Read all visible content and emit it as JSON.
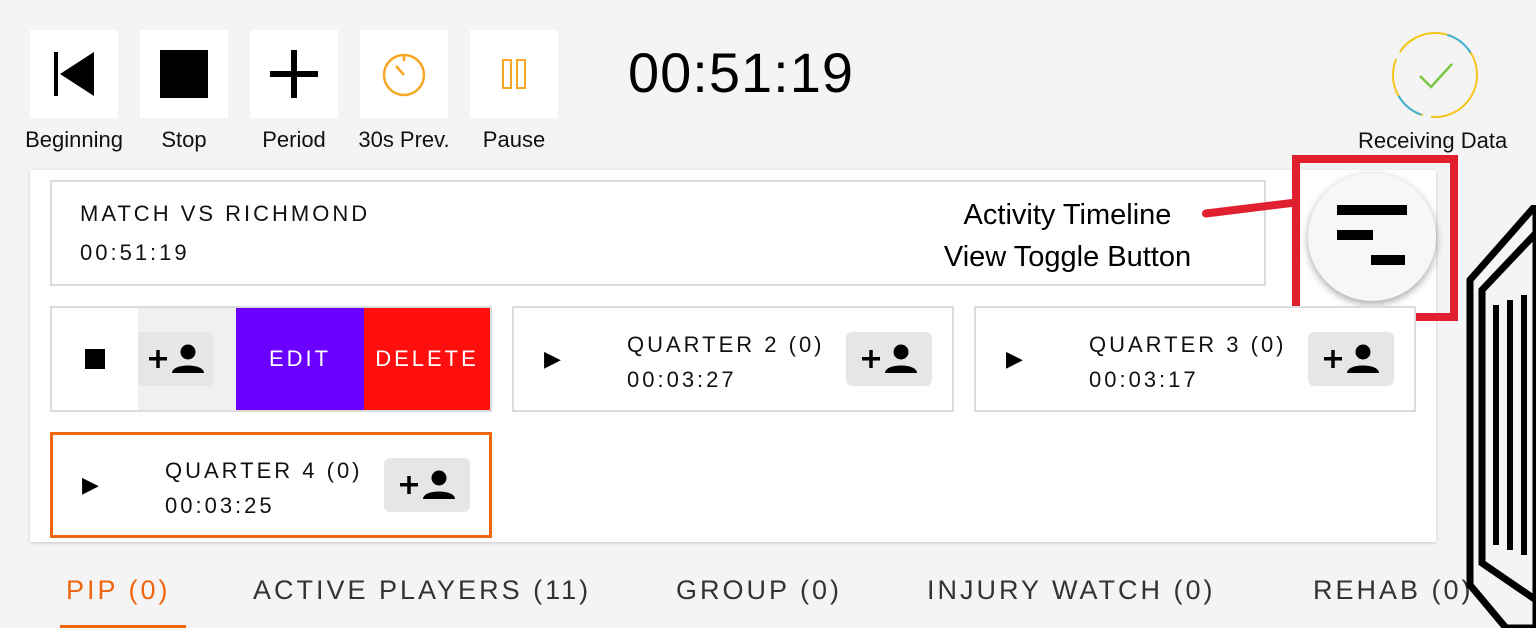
{
  "toolbar": {
    "beginning_label": "Beginning",
    "stop_label": "Stop",
    "period_label": "Period",
    "prev30_label": "30s Prev.",
    "pause_label": "Pause"
  },
  "clock": "00:51:19",
  "status": {
    "label": "Receiving Data"
  },
  "match": {
    "title": "MATCH VS RICHMOND",
    "time": "00:51:19"
  },
  "annotation": {
    "line1": "Activity Timeline",
    "line2": "View Toggle Button"
  },
  "swipe_actions": {
    "edit": "EDIT",
    "delete": "DELETE"
  },
  "periods": [
    {
      "title": "QUARTER 2 (0)",
      "time": "00:03:27"
    },
    {
      "title": "QUARTER 3 (0)",
      "time": "00:03:17"
    },
    {
      "title": "QUARTER 4 (0)",
      "time": "00:03:25"
    }
  ],
  "tabs": [
    {
      "label": "PIP (0)",
      "active": true
    },
    {
      "label": "ACTIVE PLAYERS (11)"
    },
    {
      "label": "GROUP (0)"
    },
    {
      "label": "INJURY WATCH (0)"
    },
    {
      "label": "REHAB (0)"
    }
  ],
  "colors": {
    "accent": "#f0650f",
    "edit": "#6a00ff",
    "delete": "#ff0e0e",
    "annotation": "#e0202e",
    "timer_icon": "#f5a623"
  },
  "icons": [
    "skip-to-beginning-icon",
    "stop-icon",
    "plus-icon",
    "timer-icon",
    "pause-icon",
    "checkmark-icon",
    "timeline-icon",
    "play-icon",
    "add-person-icon"
  ]
}
